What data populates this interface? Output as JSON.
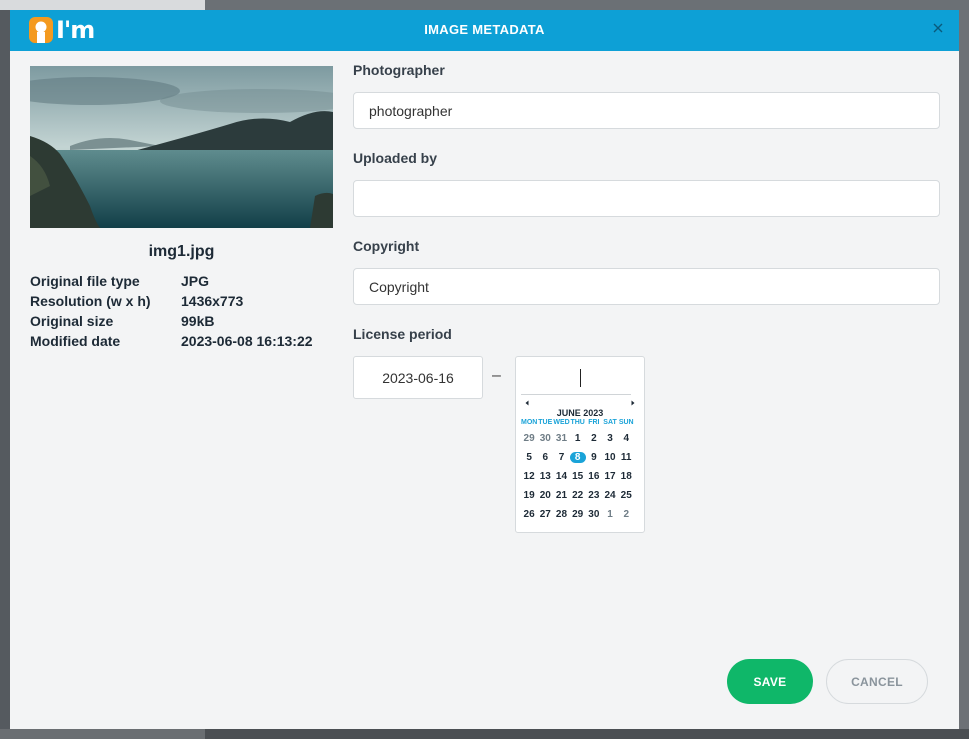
{
  "dialog": {
    "title": "IMAGE METADATA",
    "logo_text": "I'm",
    "colors": {
      "header": "#0da0d6",
      "logo_orange": "#f49a1f",
      "save": "#0fb769",
      "selected_day": "#1aa3d8"
    }
  },
  "image": {
    "file_name": "img1.jpg",
    "details": [
      {
        "label": "Original file type",
        "value": "JPG"
      },
      {
        "label": "Resolution (w x h)",
        "value": "1436x773"
      },
      {
        "label": "Original size",
        "value": "99kB"
      },
      {
        "label": "Modified date",
        "value": "2023-06-08 16:13:22"
      }
    ]
  },
  "form": {
    "photographer": {
      "label": "Photographer",
      "value": "photographer"
    },
    "uploaded_by": {
      "label": "Uploaded by",
      "value": ""
    },
    "copyright": {
      "label": "Copyright",
      "value": "Copyright"
    },
    "license_period": {
      "label": "License period",
      "from": "2023-06-16",
      "separator": "–",
      "to": ""
    }
  },
  "datepicker": {
    "month_label": "JUNE 2023",
    "weekdays": [
      "MON",
      "TUE",
      "WED",
      "THU",
      "FRI",
      "SAT",
      "SUN"
    ],
    "weeks": [
      [
        "29",
        "30",
        "31",
        "1",
        "2",
        "3",
        "4"
      ],
      [
        "5",
        "6",
        "7",
        "8",
        "9",
        "10",
        "11"
      ],
      [
        "12",
        "13",
        "14",
        "15",
        "16",
        "17",
        "18"
      ],
      [
        "19",
        "20",
        "21",
        "22",
        "23",
        "24",
        "25"
      ],
      [
        "26",
        "27",
        "28",
        "29",
        "30",
        "1",
        "2"
      ]
    ],
    "selected_day": "8"
  },
  "actions": {
    "save": "SAVE",
    "cancel": "CANCEL"
  },
  "icons": {
    "close": "close-icon",
    "prev": "chevron-left-icon",
    "next": "chevron-right-icon"
  }
}
